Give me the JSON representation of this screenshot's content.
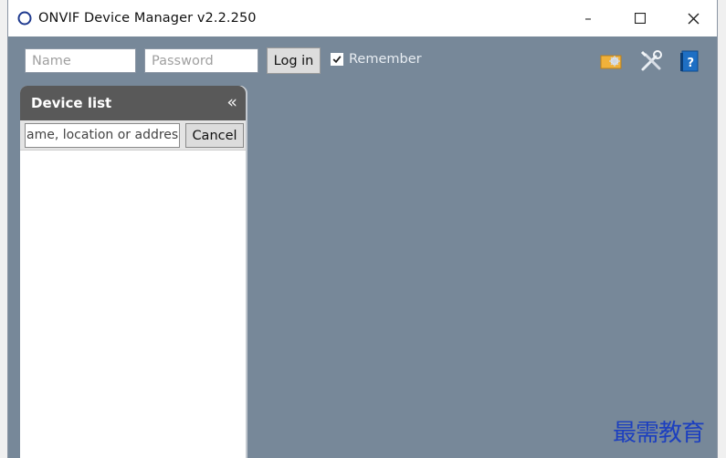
{
  "window": {
    "title": "ONVIF Device Manager v2.2.250",
    "controls": {
      "minimize": "–",
      "maximize": "☐",
      "close": "✕"
    }
  },
  "toolbar": {
    "name_placeholder": "Name",
    "password_placeholder": "Password",
    "login_label": "Log in",
    "remember_label": "Remember",
    "remember_checked": true,
    "icons": [
      "events-icon",
      "settings-tools-icon",
      "help-book-icon"
    ]
  },
  "sidebar": {
    "title": "Device list",
    "collapse_glyph": "«",
    "search_text": "ame, location or addres",
    "cancel_label": "Cancel"
  },
  "colors": {
    "workspace": "#778899",
    "panel_header": "#595959"
  },
  "watermark": "最需教育"
}
